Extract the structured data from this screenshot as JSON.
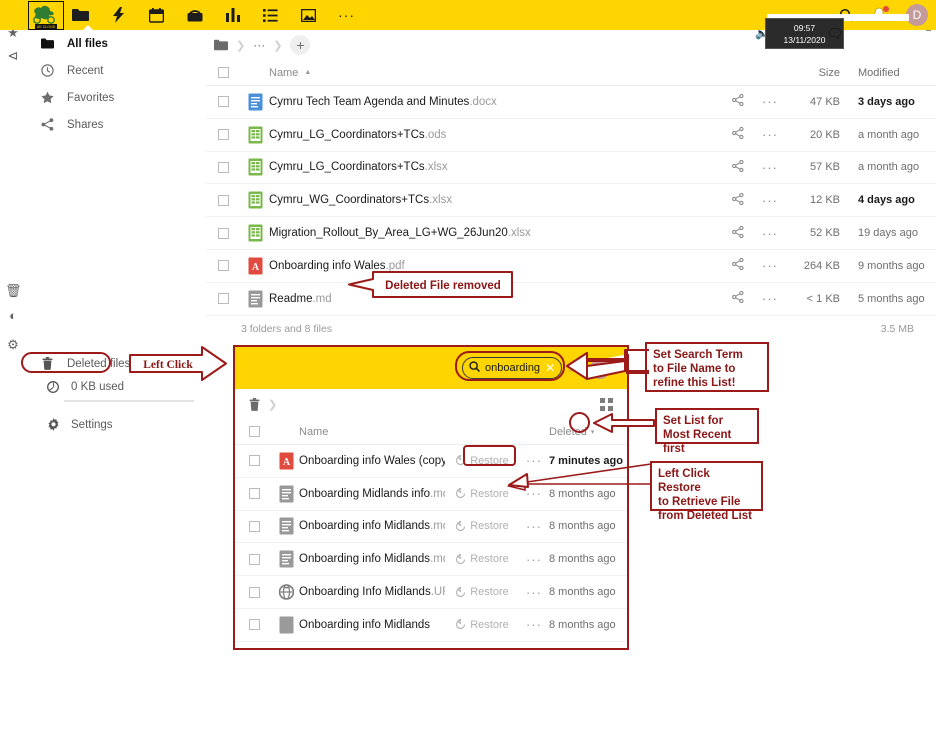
{
  "app": {
    "brand_logo_text": "UK CLOUD",
    "accent_yellow": "#ffd500",
    "annotation_red": "#9c1a1a"
  },
  "topbar": {
    "nav_icons": [
      {
        "name": "files-icon",
        "label": "Files"
      },
      {
        "name": "activity-icon",
        "label": "Activity"
      },
      {
        "name": "calendar-icon",
        "label": "Calendar"
      },
      {
        "name": "mail-icon",
        "label": "Mail"
      },
      {
        "name": "analytics-icon",
        "label": "Analytics"
      },
      {
        "name": "tasks-icon",
        "label": "Tasks"
      },
      {
        "name": "photos-icon",
        "label": "Photos"
      },
      {
        "name": "more-apps-icon",
        "label": "..."
      }
    ],
    "search_label": "Search",
    "notifications_label": "Notifications",
    "avatar_initial": "D"
  },
  "clock": {
    "time": "09:57",
    "date": "13/11/2020"
  },
  "sidebar": {
    "items": [
      {
        "label": "All files",
        "icon": "folder-icon",
        "active": true
      },
      {
        "label": "Recent",
        "icon": "clock-icon",
        "active": false
      },
      {
        "label": "Favorites",
        "icon": "star-icon",
        "active": false
      },
      {
        "label": "Shares",
        "icon": "share-icon",
        "active": false
      }
    ],
    "bottom": [
      {
        "label": "Deleted files",
        "icon": "trash-icon"
      },
      {
        "label": "0 KB used",
        "icon": "pie-icon"
      },
      {
        "label": "Settings",
        "icon": "gear-icon"
      }
    ]
  },
  "breadcrumb": {
    "home_label": "Home",
    "ellipsis": "···",
    "add_label": "+"
  },
  "files": {
    "columns": {
      "name": "Name",
      "size": "Size",
      "modified": "Modified"
    },
    "sort_indicator": "▲",
    "rows": [
      {
        "name": "Cymru Tech Team Agenda and Minutes",
        "ext": ".docx",
        "type": "doc",
        "size": "47 KB",
        "modified": "3 days ago",
        "modified_strong": true
      },
      {
        "name": "Cymru_LG_Coordinators+TCs",
        "ext": ".ods",
        "type": "sheet",
        "size": "20 KB",
        "modified": "a month ago",
        "modified_strong": false
      },
      {
        "name": "Cymru_LG_Coordinators+TCs",
        "ext": ".xlsx",
        "type": "sheet",
        "size": "57 KB",
        "modified": "a month ago",
        "modified_strong": false
      },
      {
        "name": "Cymru_WG_Coordinators+TCs",
        "ext": ".xlsx",
        "type": "sheet",
        "size": "12 KB",
        "modified": "4 days ago",
        "modified_strong": true
      },
      {
        "name": "Migration_Rollout_By_Area_LG+WG_26Jun20",
        "ext": ".xlsx",
        "type": "sheet",
        "size": "52 KB",
        "modified": "19 days ago",
        "modified_strong": false
      },
      {
        "name": "Onboarding info Wales",
        "ext": ".pdf",
        "type": "pdf",
        "size": "264 KB",
        "modified": "9 months ago",
        "modified_strong": false
      },
      {
        "name": "Readme",
        "ext": ".md",
        "type": "md",
        "size": "< 1 KB",
        "modified": "5 months ago",
        "modified_strong": false
      }
    ],
    "summary_left": "3 folders and 8 files",
    "summary_right": "3.5 MB"
  },
  "trash": {
    "search_value": "onboarding",
    "search_placeholder": "Search",
    "avatar_initial": "D",
    "columns": {
      "name": "Name",
      "deleted": "Deleted"
    },
    "restore_label": "Restore",
    "rows": [
      {
        "name": "Onboarding info Wales (copy)",
        "ext": ".pdf",
        "type": "pdf",
        "deleted": "7 minutes ago",
        "deleted_strong": true
      },
      {
        "name": "Onboarding Midlands info",
        "ext": ".md",
        "type": "md",
        "deleted": "8 months ago",
        "deleted_strong": false
      },
      {
        "name": "Onboarding info Midlands",
        "ext": ".md",
        "type": "md",
        "deleted": "8 months ago",
        "deleted_strong": false
      },
      {
        "name": "Onboarding info Midlands",
        "ext": ".md",
        "type": "md",
        "deleted": "8 months ago",
        "deleted_strong": false
      },
      {
        "name": "Onboarding Info Midlands",
        "ext": ".URL",
        "type": "url",
        "deleted": "8 months ago",
        "deleted_strong": false
      },
      {
        "name": "Onboarding info Midlands",
        "ext": "",
        "type": "blank",
        "deleted": "8 months ago",
        "deleted_strong": false
      }
    ]
  },
  "annotations": {
    "deleted_file_removed": "Deleted File removed",
    "left_click": "Left Click",
    "set_search_term": "Set Search Term\nto File Name to\nrefine this List!",
    "set_search_term_l1": "Set Search Term",
    "set_search_term_l2": "to File Name to",
    "set_search_term_l3": "refine this List!",
    "set_list_l1": "Set List for",
    "set_list_l2": "Most Recent first",
    "restore_l1": "Left Click Restore",
    "restore_l2": "to Retrieve File",
    "restore_l3": "from Deleted List"
  }
}
